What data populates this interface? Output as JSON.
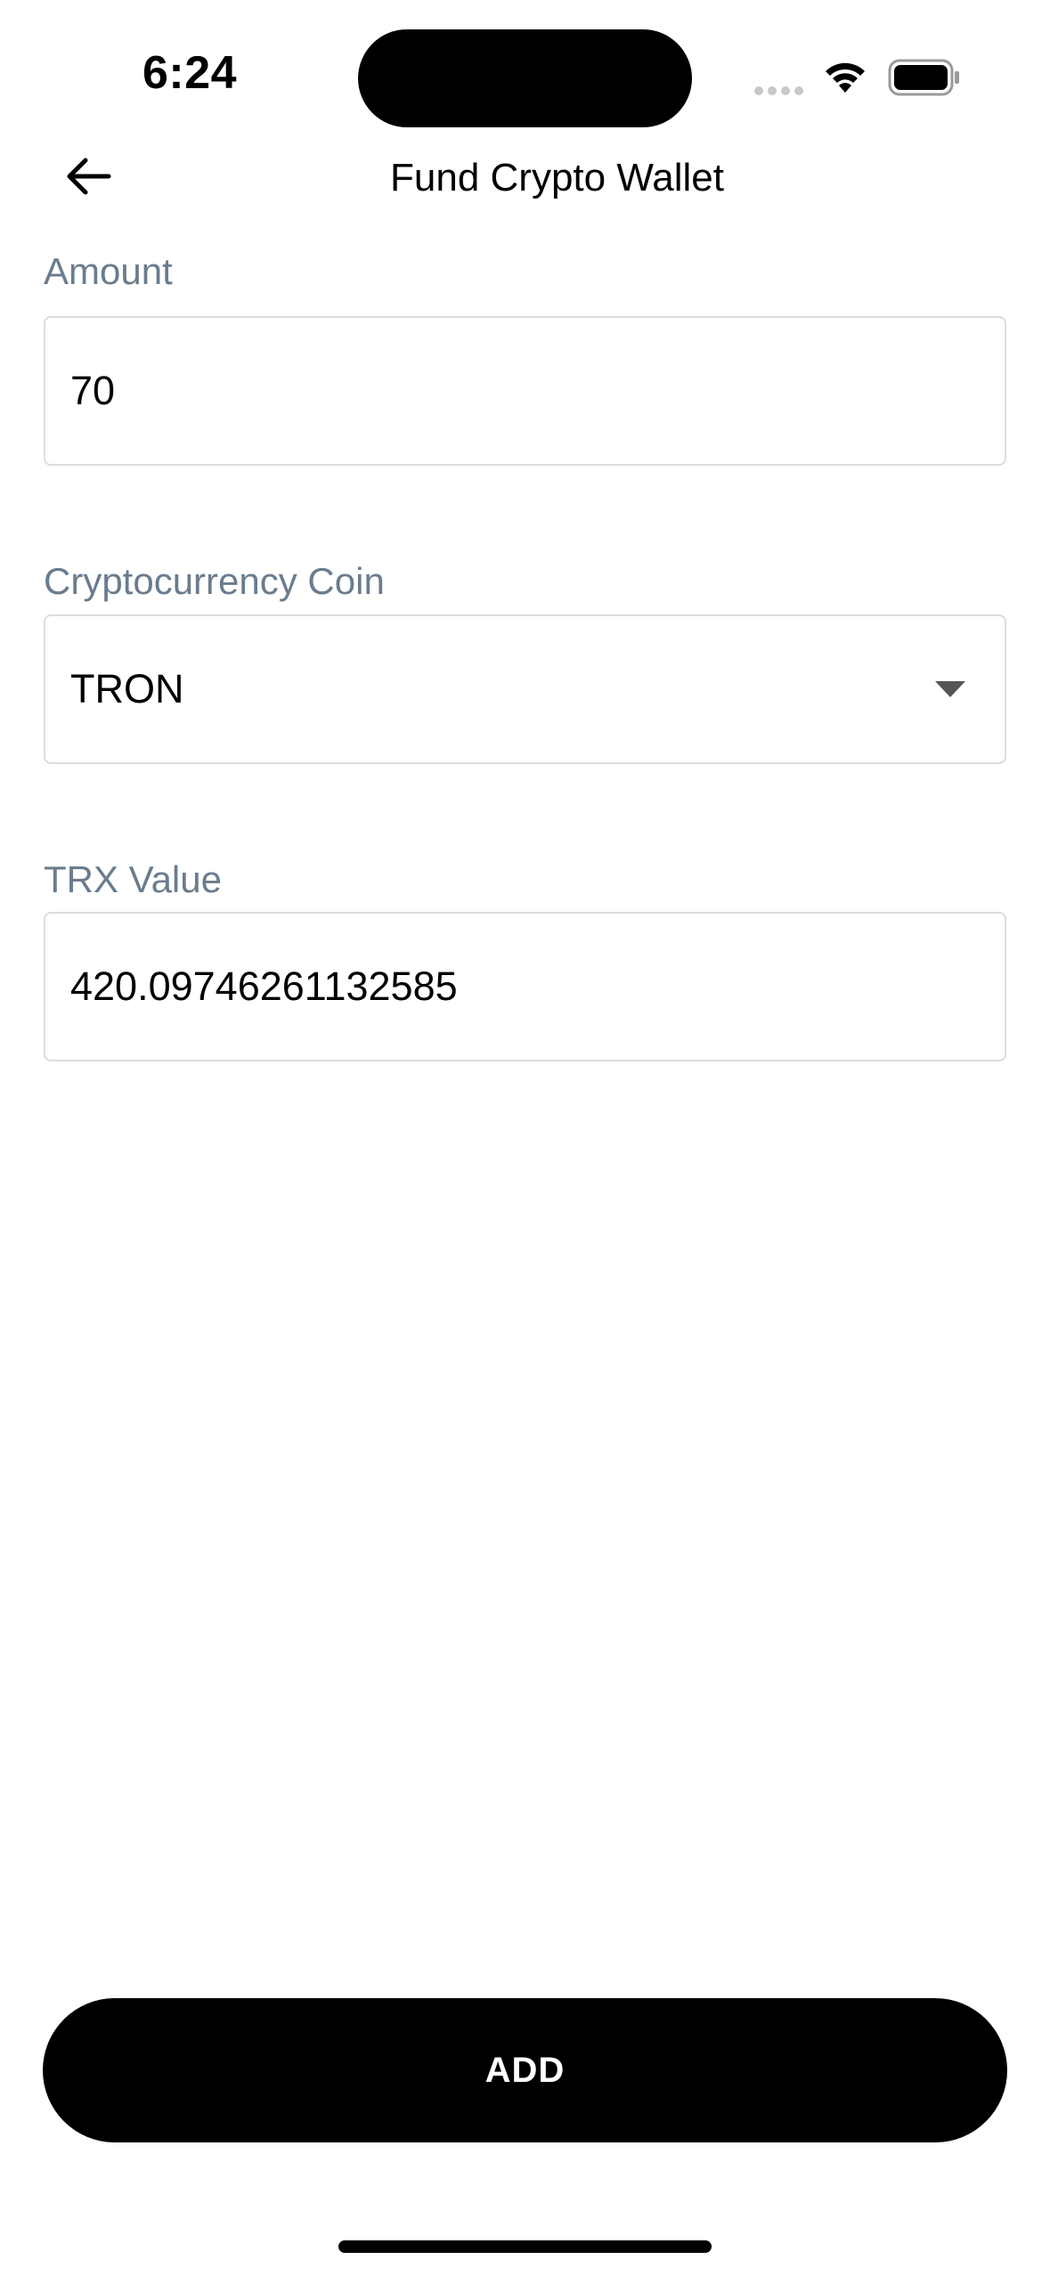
{
  "status_bar": {
    "time": "6:24"
  },
  "header": {
    "title": "Fund Crypto Wallet",
    "back_icon": "arrow-left-icon"
  },
  "form": {
    "amount": {
      "label": "Amount",
      "value": "70"
    },
    "coin": {
      "label": "Cryptocurrency Coin",
      "value": "TRON",
      "icon": "caret-down-icon"
    },
    "trx_value": {
      "label": "TRX Value",
      "value": "420.09746261132585"
    }
  },
  "actions": {
    "add_label": "ADD"
  },
  "colors": {
    "label": "#6a7c8e",
    "border": "#dcdcdc",
    "button_bg": "#000000",
    "button_text": "#ffffff"
  }
}
